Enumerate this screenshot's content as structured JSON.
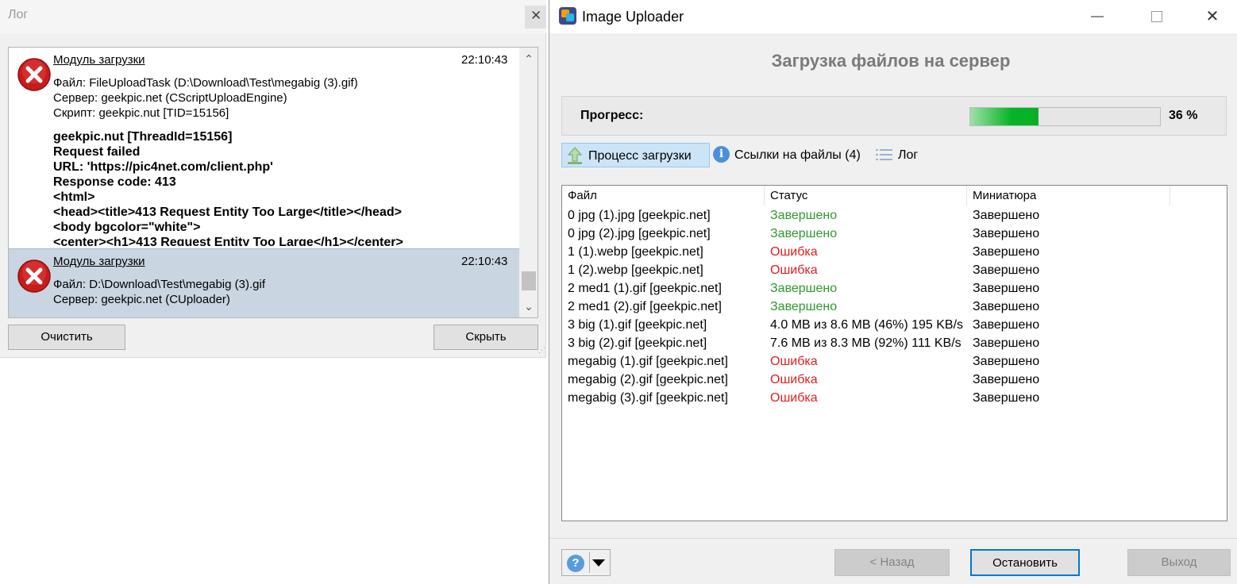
{
  "log_window": {
    "title": "Лог",
    "close_glyph": "✕",
    "entries": [
      {
        "module": "Модуль загрузки",
        "time": "22:10:43",
        "lines": [
          "Файл: FileUploadTask (D:\\Download\\Test\\megabig (3).gif)",
          "Сервер: geekpic.net (CScriptUploadEngine)",
          "Скрипт: geekpic.nut [TID=15156]"
        ],
        "details": [
          "geekpic.nut [ThreadId=15156]",
          "Request failed",
          "URL: 'https://pic4net.com/client.php'",
          "Response code: 413",
          "<html>",
          "<head><title>413 Request Entity Too Large</title></head>",
          "<body bgcolor=\"white\">",
          "<center><h1>413 Request Entity Too Large</h1></center>"
        ],
        "icon": "error-icon"
      },
      {
        "module": "Модуль загрузки",
        "time": "22:10:43",
        "lines": [
          "Файл: D:\\Download\\Test\\megabig (3).gif",
          "Сервер: geekpic.net (CUploader)"
        ],
        "icon": "error-icon",
        "selected": true
      }
    ],
    "scroll_up_glyph": "⌃",
    "scroll_down_glyph": "⌄",
    "clear_label": "Очистить",
    "hide_label": "Скрыть"
  },
  "uploader": {
    "title": "Image Uploader",
    "heading": "Загрузка файлов на сервер",
    "progress_label": "Прогресс:",
    "progress_percent": 36,
    "progress_text": "36 %",
    "tabs": [
      {
        "label": "Процесс загрузки",
        "icon": "upload-arrow-icon",
        "active": true
      },
      {
        "label": "Ссылки на файлы (4)",
        "icon": "info-icon",
        "active": false
      },
      {
        "label": "Лог",
        "icon": "list-icon",
        "active": false
      }
    ],
    "table": {
      "columns": [
        "Файл",
        "Статус",
        "Миниатюра"
      ],
      "rows": [
        {
          "file": "0 jpg (1).jpg [geekpic.net]",
          "status": "Завершено",
          "thumb": "Завершено",
          "state": "ok"
        },
        {
          "file": "0 jpg (2).jpg [geekpic.net]",
          "status": "Завершено",
          "thumb": "Завершено",
          "state": "ok"
        },
        {
          "file": "1 (1).webp [geekpic.net]",
          "status": "Ошибка",
          "thumb": "Завершено",
          "state": "error"
        },
        {
          "file": "1 (2).webp [geekpic.net]",
          "status": "Ошибка",
          "thumb": "Завершено",
          "state": "error"
        },
        {
          "file": "2 med1 (1).gif [geekpic.net]",
          "status": "Завершено",
          "thumb": "Завершено",
          "state": "ok"
        },
        {
          "file": "2 med1 (2).gif [geekpic.net]",
          "status": "Завершено",
          "thumb": "Завершено",
          "state": "ok"
        },
        {
          "file": "3 big (1).gif [geekpic.net]",
          "status": "4.0 MB из 8.6 MB (46%) 195 KB/s",
          "thumb": "Завершено",
          "state": "progress"
        },
        {
          "file": "3 big (2).gif [geekpic.net]",
          "status": "7.6 MB из 8.3 MB (92%) 111 KB/s",
          "thumb": "Завершено",
          "state": "progress"
        },
        {
          "file": "megabig (1).gif [geekpic.net]",
          "status": "Ошибка",
          "thumb": "Завершено",
          "state": "error"
        },
        {
          "file": "megabig (2).gif [geekpic.net]",
          "status": "Ошибка",
          "thumb": "Завершено",
          "state": "error"
        },
        {
          "file": "megabig (3).gif [geekpic.net]",
          "status": "Ошибка",
          "thumb": "Завершено",
          "state": "error"
        }
      ]
    },
    "status_colors": {
      "ok": "#2e9a2e",
      "error": "#e02020",
      "progress": "#000000"
    },
    "help_glyph": "?",
    "back_label": "< Назад",
    "stop_label": "Остановить",
    "exit_label": "Выход",
    "window_controls": {
      "minimize": "—",
      "close": "✕"
    }
  }
}
